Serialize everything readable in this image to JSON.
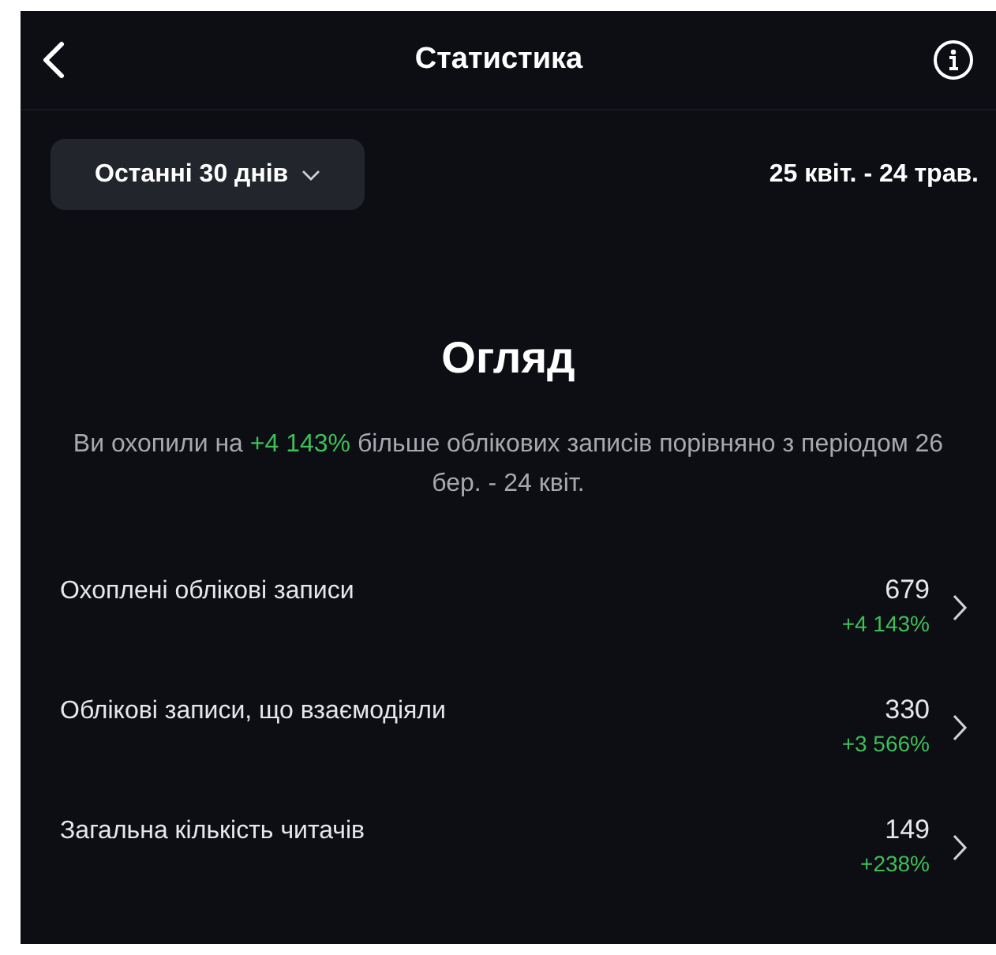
{
  "header": {
    "title": "Статистика"
  },
  "period": {
    "label": "Останні 30 днів",
    "range": "25 квіт. - 24 трав."
  },
  "overview": {
    "title": "Огляд",
    "summary_before": "Ви охопили на ",
    "summary_highlight": "+4 143%",
    "summary_after": " більше облікових записів порівняно з періодом 26 бер. - 24 квіт."
  },
  "metrics": [
    {
      "label": "Охоплені облікові записи",
      "value": "679",
      "change": "+4 143%"
    },
    {
      "label": "Облікові записи, що взаємодіяли",
      "value": "330",
      "change": "+3 566%"
    },
    {
      "label": "Загальна кількість читачів",
      "value": "149",
      "change": "+238%"
    }
  ]
}
